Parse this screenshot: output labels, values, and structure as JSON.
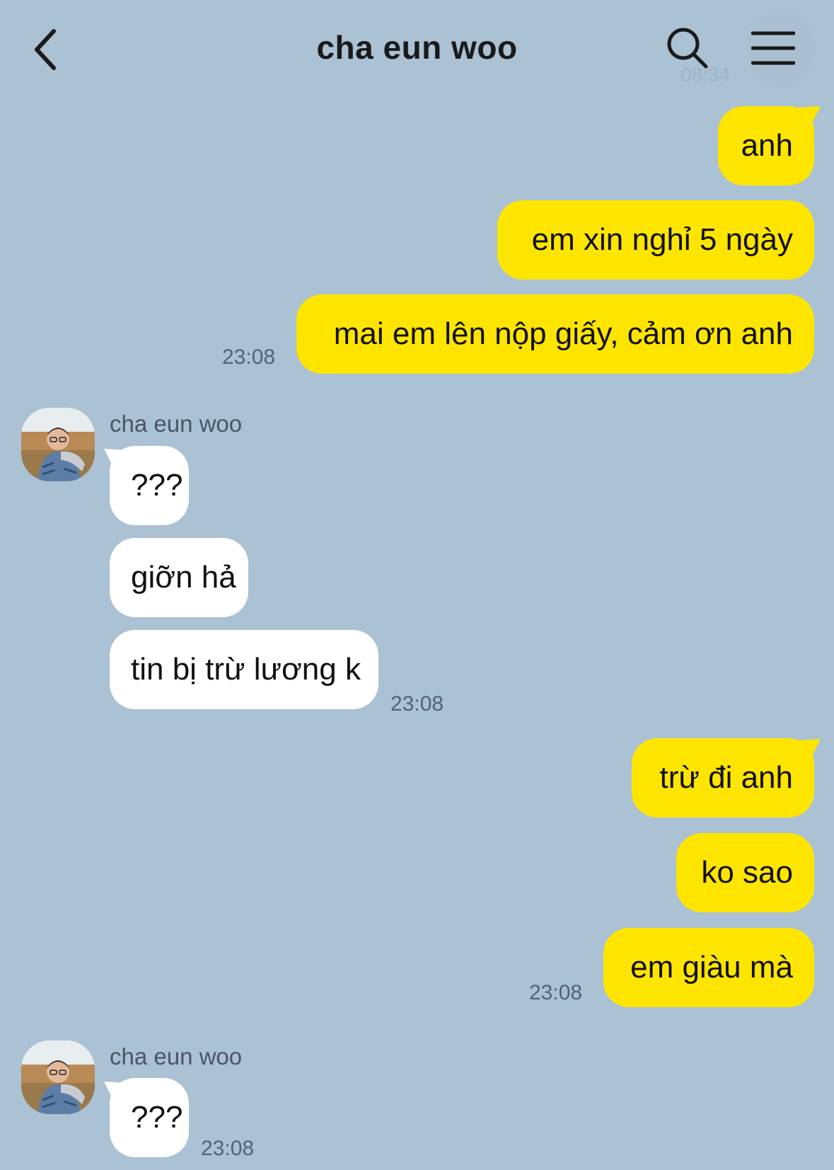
{
  "header": {
    "title": "cha eun woo",
    "ghost_time": "08:34"
  },
  "icons": {
    "back": "chevron-left-icon",
    "search": "search-icon",
    "menu": "hamburger-menu-icon"
  },
  "colors": {
    "background": "#abc1d4",
    "my_bubble": "#fee500",
    "their_bubble": "#ffffff"
  },
  "messages": {
    "g1": {
      "m1": "anh",
      "m2": "em xin nghỉ 5 ngày",
      "m3": "mai em lên nộp giấy, cảm ơn anh",
      "time": "23:08"
    },
    "g2": {
      "sender": "cha eun woo",
      "m1": "???",
      "m2": "giỡn hả",
      "m3": "tin bị trừ lương k",
      "time": "23:08"
    },
    "g3": {
      "m1": "trừ đi anh",
      "m2": "ko sao",
      "m3": "em giàu mà",
      "time": "23:08"
    },
    "g4": {
      "sender": "cha eun woo",
      "m1": "???",
      "time": "23:08"
    }
  }
}
